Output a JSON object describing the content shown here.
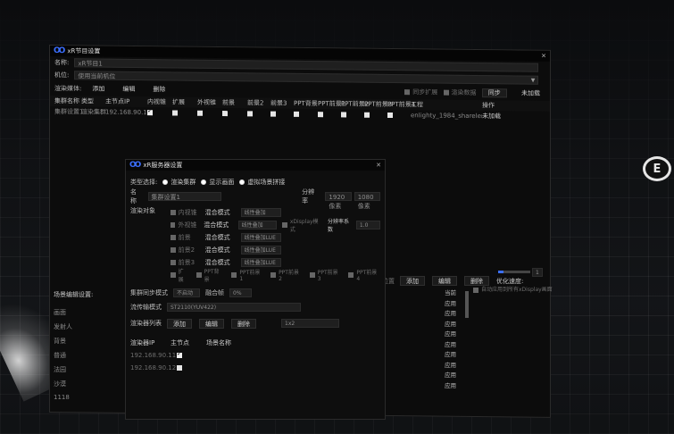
{
  "main": {
    "title": "xR节目设置",
    "name_label": "名称:",
    "name_value": "xR节目1",
    "camera_label": "机位:",
    "camera_value": "使用当前机位",
    "render_media_label": "渲染媒体:",
    "add": "添加",
    "edit": "编辑",
    "delete": "删除",
    "sync_check": "同步扩展",
    "render_check": "渲染数据",
    "sync_btn": "同步",
    "cancel_btn": "未加载",
    "columns": [
      "集群名称",
      "类型",
      "主节点IP",
      "内视锥",
      "扩展",
      "外视锥",
      "前景",
      "前景2",
      "前景3",
      "PPT背景",
      "PPT前景1",
      "PPT前景2",
      "PPT前景3",
      "PPT前景4",
      "工程",
      "操作"
    ],
    "row": {
      "name": "集群设置1",
      "type": "渲染集群",
      "ip": "192.168.90.12",
      "project": "enlighty_1984_sharelenlighty",
      "action": "未加载"
    }
  },
  "dialog": {
    "title": "xR服务器设置",
    "type_label": "类型选择:",
    "opt1": "渲染集群",
    "opt2": "显示画面",
    "opt3": "虚拟场景拼接",
    "name_label": "名称",
    "name_value": "集群设置1",
    "resolution_label": "分辨率",
    "res_w": "1920像素",
    "res_h": "1080像素",
    "render_obj_label": "渲染对象",
    "layers": [
      {
        "name": "内视锥",
        "mode": "混合模式",
        "blend": "线性叠加"
      },
      {
        "name": "外视锥",
        "mode": "混合模式",
        "blend": "线性叠加"
      },
      {
        "name": "前景",
        "mode": "混合模式",
        "blend": "线性叠加LUE"
      },
      {
        "name": "前景2",
        "mode": "混合模式",
        "blend": "线性叠加LUE"
      },
      {
        "name": "前景3",
        "mode": "混合模式",
        "blend": "线性叠加LUE"
      }
    ],
    "xdisplay": "xDisplay模式",
    "res_coef_label": "分辨率系数",
    "res_coef": "1.0",
    "ext_row": [
      "扩展",
      "PPT背景",
      "PPT前景1",
      "PPT前景2",
      "PPT前景3",
      "PPT前景4"
    ],
    "sync_mode_label": "集群同步模式",
    "sync_mode": "不启动",
    "frame_label": "融合帧",
    "frame_value": "0%",
    "stream_mode_label": "流传输模式",
    "stream_mode": "ST2110(YUV422)",
    "list_label": "渲染器列表",
    "list_ip": "渲染器IP",
    "list_master": "主节点",
    "list_scene": "场景名称",
    "rows": [
      "192.168.90.11",
      "192.168.90.12"
    ],
    "layout": "1x2"
  },
  "side": {
    "scene_settings": "场景编辑设置:",
    "labels": [
      "画面",
      "发射人",
      "背景",
      "普通",
      "法园",
      "沙漠",
      "1118"
    ],
    "right": [
      "当前",
      "应用",
      "应用",
      "应用",
      "应用",
      "应用",
      "应用",
      "应用",
      "应用",
      "应用"
    ],
    "slider_label": "优化速度:",
    "slider_value": "1",
    "add": "添加",
    "edit": "编辑",
    "delete": "删除",
    "preset": "位置",
    "auto_check": "自动应用到所有xDisplay画面"
  }
}
